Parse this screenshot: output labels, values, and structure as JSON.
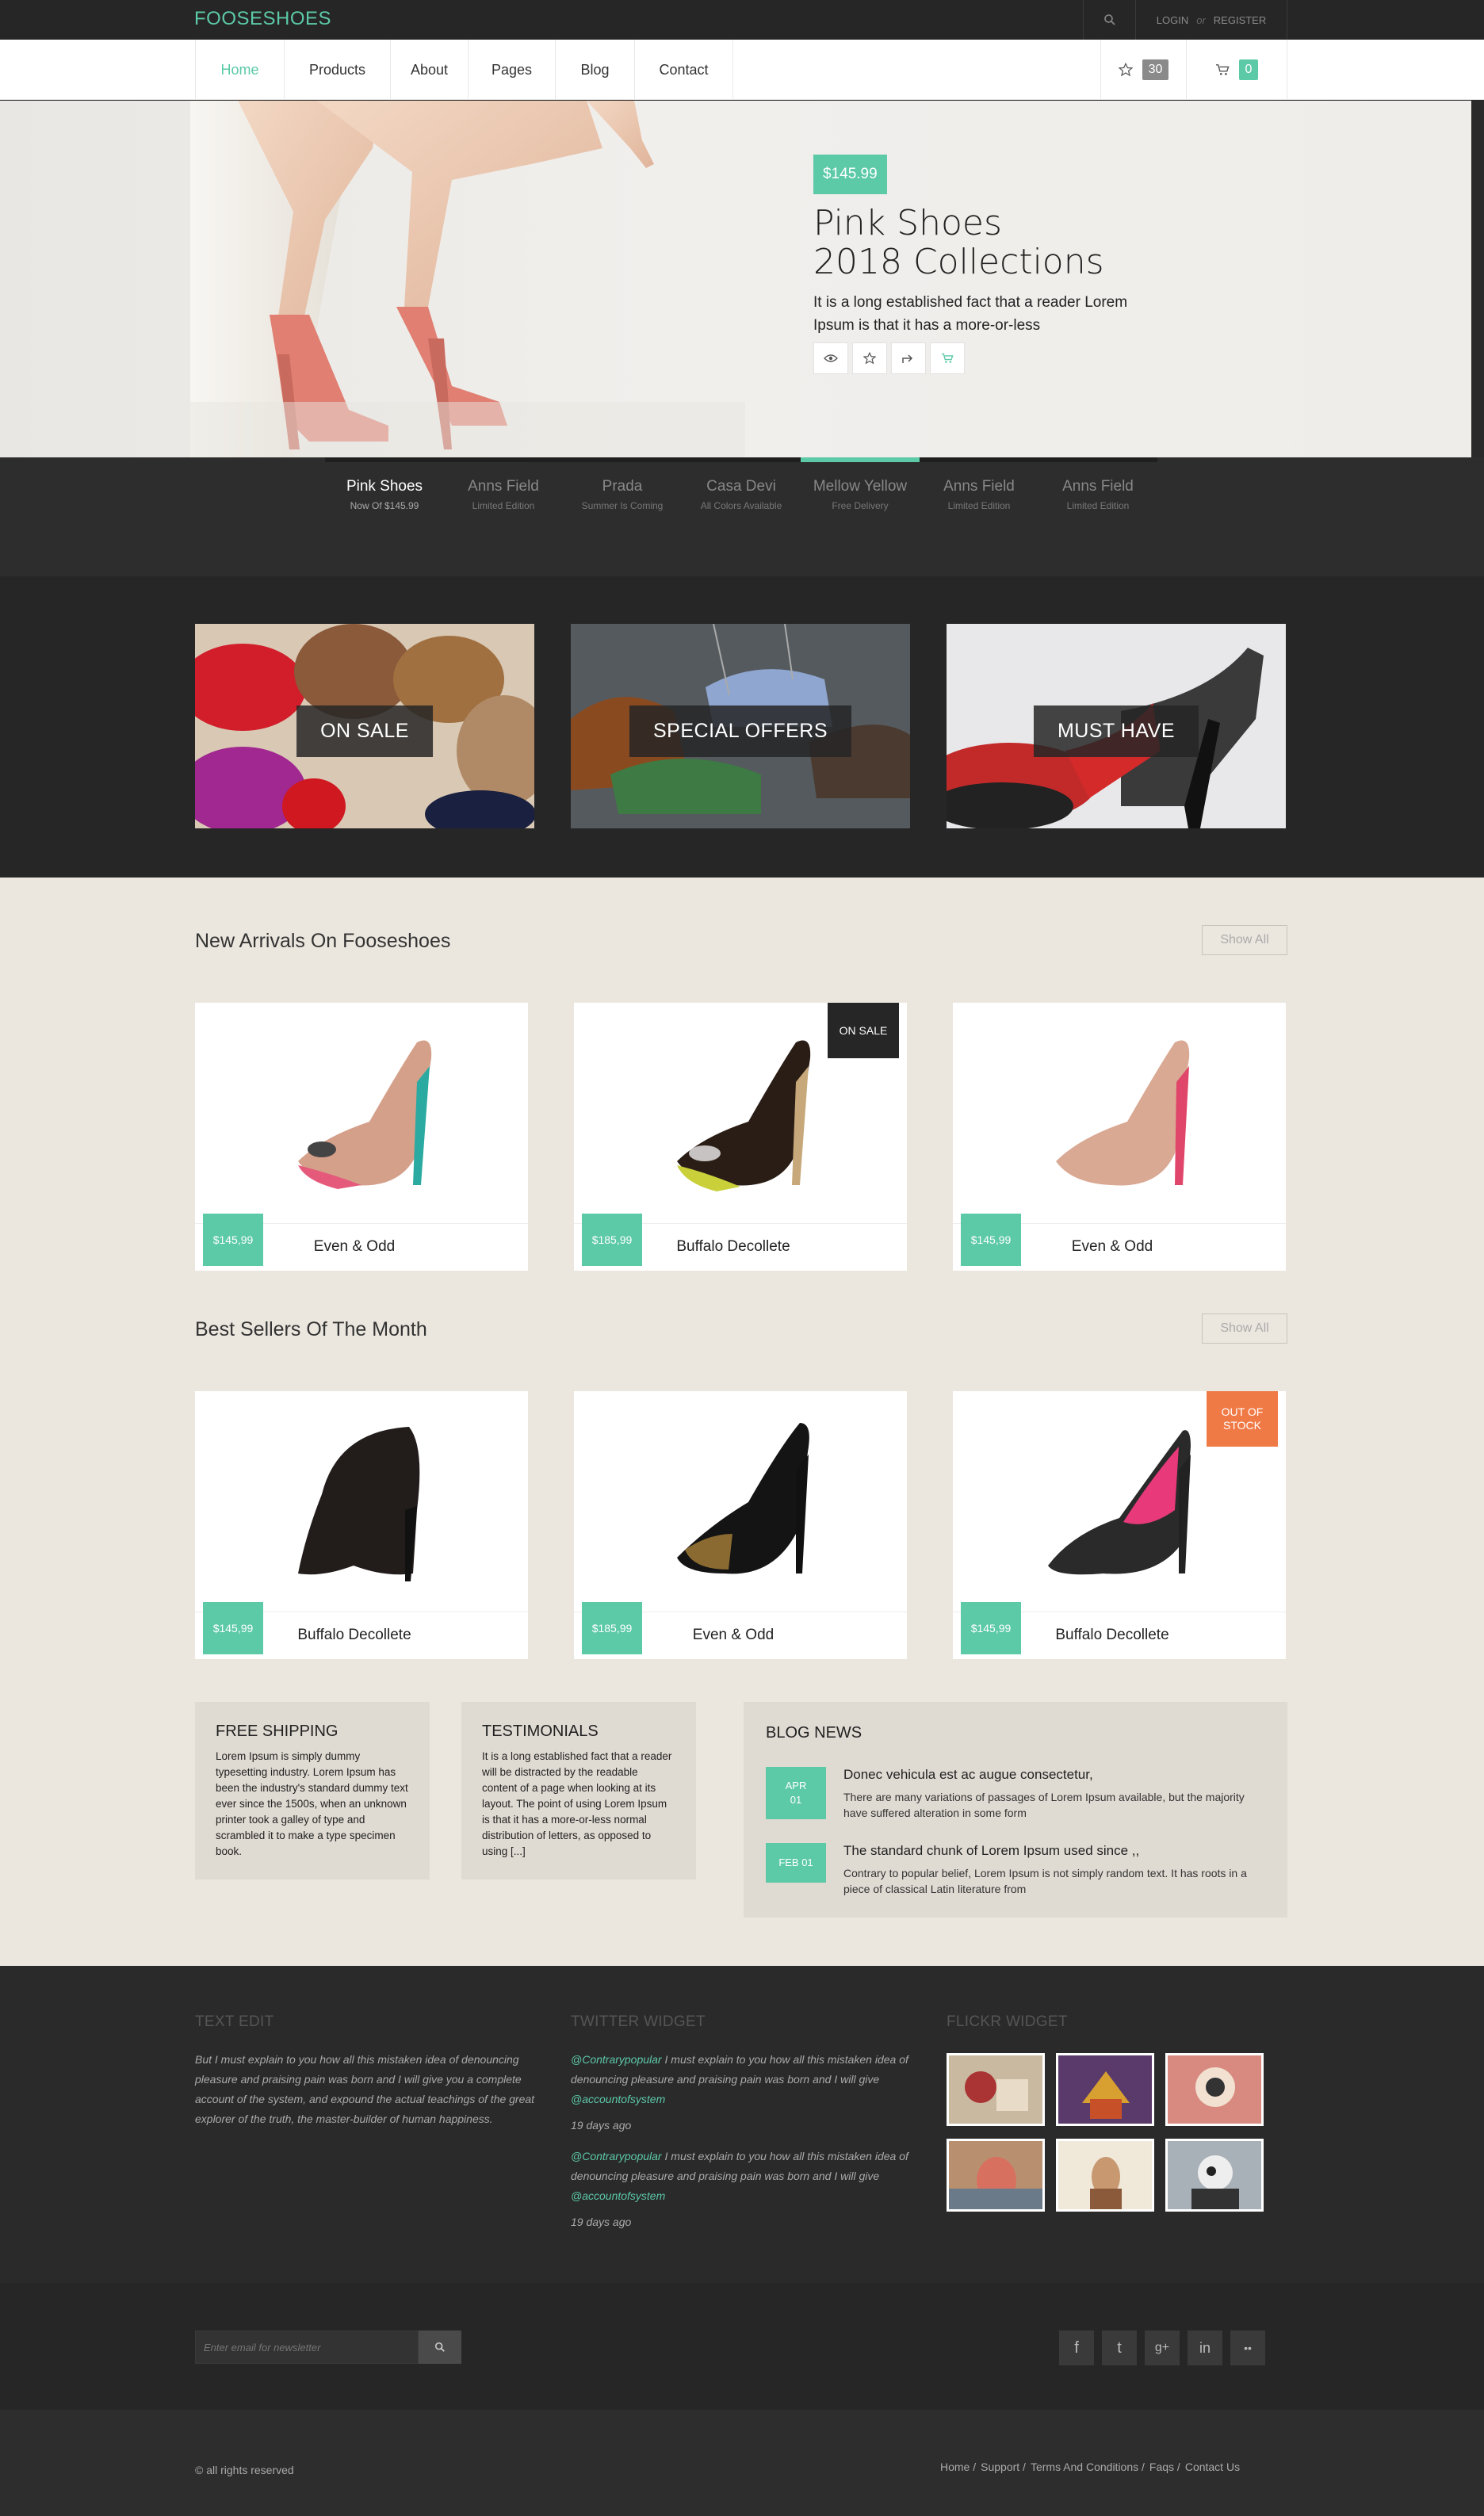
{
  "header": {
    "logo": "FOOSESHOES",
    "login": "LOGIN",
    "or": "or",
    "register": "REGISTER"
  },
  "nav": {
    "items": [
      {
        "label": "Home",
        "active": true
      },
      {
        "label": "Products"
      },
      {
        "label": "About"
      },
      {
        "label": "Pages"
      },
      {
        "label": "Blog"
      },
      {
        "label": "Contact"
      }
    ],
    "wishlist_count": "30",
    "cart_count": "0"
  },
  "hero": {
    "price": "$145.99",
    "title_line1": "Pink Shoes",
    "title_line2": "2018 Collections",
    "text": "It is a long established fact that a reader Lorem Ipsum is that it has a more-or-less"
  },
  "slider_tabs": [
    {
      "title": "Pink Shoes",
      "sub": "Now Of $145.99"
    },
    {
      "title": "Anns Field",
      "sub": "Limited Edition"
    },
    {
      "title": "Prada",
      "sub": "Summer Is Coming"
    },
    {
      "title": "Casa Devi",
      "sub": "All Colors Available"
    },
    {
      "title": "Mellow Yellow",
      "sub": "Free Delivery"
    },
    {
      "title": "Anns Field",
      "sub": "Limited Edition"
    },
    {
      "title": "Anns Field",
      "sub": "Limited Edition"
    }
  ],
  "categories": [
    "ON SALE",
    "SPECIAL OFFERS",
    "MUST HAVE"
  ],
  "new_arrivals": {
    "title": "New Arrivals On Fooseshoes",
    "show_all": "Show All",
    "items": [
      {
        "price": "$145,99",
        "name": "Even & Odd"
      },
      {
        "price": "$185,99",
        "name": "Buffalo Decollete",
        "ribbon": "ON SALE"
      },
      {
        "price": "$145,99",
        "name": "Even & Odd"
      }
    ]
  },
  "best_sellers": {
    "title": "Best Sellers Of The Month",
    "show_all": "Show All",
    "items": [
      {
        "price": "$145,99",
        "name": "Buffalo Decollete"
      },
      {
        "price": "$185,99",
        "name": "Even & Odd"
      },
      {
        "price": "$145,99",
        "name": "Buffalo Decollete",
        "ribbon": "OUT OF STOCK"
      }
    ]
  },
  "widgets": {
    "shipping": {
      "title": "FREE SHIPPING",
      "text": "Lorem Ipsum is simply dummy typesetting industry. Lorem Ipsum has been the industry's standard dummy text ever since the 1500s, when an unknown printer took a galley of type and scrambled it to make a type specimen book."
    },
    "testimonials": {
      "title": "TESTIMONIALS",
      "text": "It is a long established fact that a reader will be distracted by the readable content of a page when looking at its layout. The point of using Lorem Ipsum is that it has a more-or-less normal distribution of letters, as opposed to using [...]"
    },
    "blog": {
      "title": "BLOG NEWS",
      "posts": [
        {
          "date_line1": "APR",
          "date_line2": "01",
          "title": "Donec vehicula est ac augue consectetur,",
          "text": "There are many variations of passages of Lorem Ipsum available, but the majority have suffered alteration in some form"
        },
        {
          "date_line1": "FEB 01",
          "date_line2": "",
          "title": "The standard chunk of Lorem Ipsum used since ,,",
          "text": "Contrary to popular belief, Lorem Ipsum is not simply random text. It has roots in a piece of classical Latin literature from"
        }
      ]
    }
  },
  "footer": {
    "text_edit": {
      "title": "TEXT EDIT",
      "text": "But I must explain to you how all this mistaken idea of denouncing pleasure and praising pain was born and I will give you a complete account of the system, and expound the actual teachings of the great explorer of the truth, the master-builder of human happiness."
    },
    "twitter": {
      "title": "TWITTER WIDGET",
      "tweets": [
        {
          "user": "@Contrarypopular",
          "text": " I must explain to you how all this mistaken idea of denouncing pleasure and praising pain was born and I will give ",
          "mention": "@accountofsystem",
          "time": "19 days ago"
        },
        {
          "user": "@Contrarypopular",
          "text": " I must explain to you how all this mistaken idea of denouncing pleasure and praising pain was born and I will give ",
          "mention": "@accountofsystem",
          "time": "19 days ago"
        }
      ]
    },
    "flickr": {
      "title": "FLICKR WIDGET"
    },
    "newsletter_placeholder": "Enter email for newsletter",
    "social": [
      "f",
      "t",
      "g+",
      "in",
      "••"
    ],
    "copyright": "© all rights reserved",
    "links": [
      "Home /",
      "Support /",
      "Terms And Conditions /",
      "Faqs /",
      "Contact Us"
    ]
  },
  "colors": {
    "accent": "#5cc9a7",
    "dark": "#262626",
    "orange": "#f07a46"
  }
}
